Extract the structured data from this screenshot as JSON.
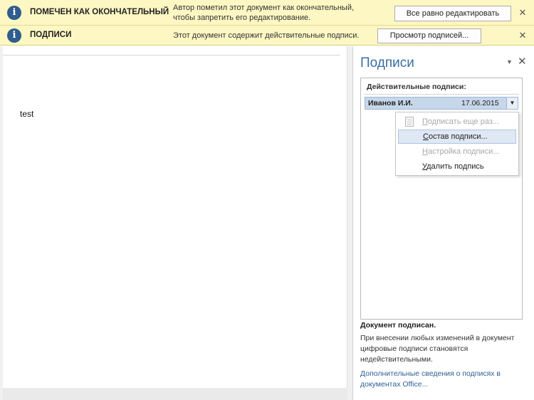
{
  "colors": {
    "message_bar_bg": "#fdf7c3",
    "info_icon": "#2e5d8e",
    "pane_title": "#3a6ea5",
    "selected_row": "#c7d7ea",
    "link": "#2f5f95"
  },
  "message_bars": [
    {
      "icon": "info-icon",
      "title": "ПОМЕЧЕН КАК ОКОНЧАТЕЛЬНЫЙ",
      "text": "Автор пометил этот документ как окончательный, чтобы запретить его редактирование.",
      "button": "Все равно редактировать",
      "close": "✕"
    },
    {
      "icon": "info-icon",
      "title": "ПОДПИСИ",
      "text": "Этот документ содержит действительные подписи.",
      "button": "Просмотр подписей...",
      "close": "✕"
    }
  ],
  "document": {
    "text": "test"
  },
  "signatures_pane": {
    "title": "Подписи",
    "dropdown_icon": "▼",
    "close_icon": "✕",
    "valid_header": "Действительные подписи:",
    "signature": {
      "name": "Иванов И.И.",
      "date": "17.06.2015",
      "menu_arrow": "▼"
    },
    "context_menu": [
      {
        "prefix": "",
        "underline": "П",
        "rest": "одписать еще раз...",
        "disabled": true,
        "hover": false,
        "icon": "sign-document-icon"
      },
      {
        "prefix": "",
        "underline": "С",
        "rest": "остав подписи...",
        "disabled": false,
        "hover": true,
        "icon": ""
      },
      {
        "prefix": "",
        "underline": "Н",
        "rest": "астройка подписи...",
        "disabled": true,
        "hover": false,
        "icon": ""
      },
      {
        "prefix": "",
        "underline": "У",
        "rest": "далить подпись",
        "disabled": false,
        "hover": false,
        "icon": ""
      }
    ],
    "status_title": "Документ подписан.",
    "status_text": "При внесении любых изменений в документ цифровые подписи становятся недействительными.",
    "more_link": "Дополнительные сведения о подписях в документах Office..."
  }
}
